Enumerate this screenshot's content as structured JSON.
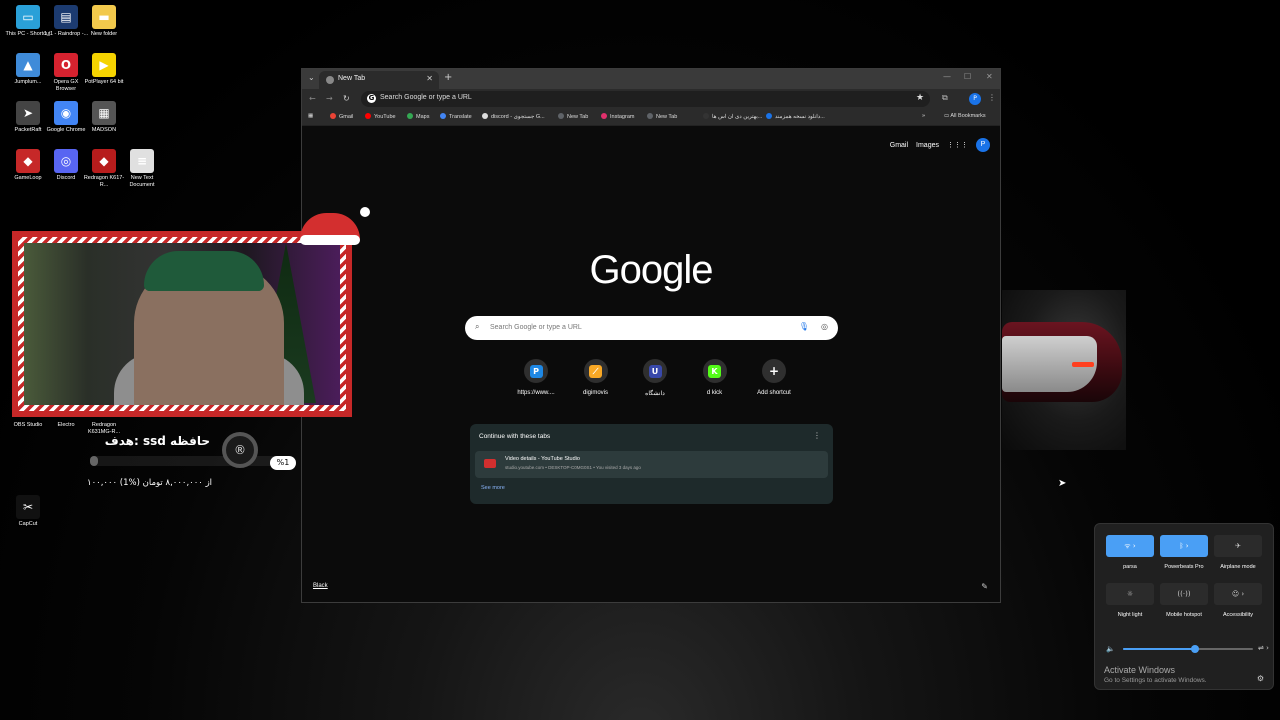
{
  "desktop": {
    "icons": [
      {
        "label": "This PC - Shortcut",
        "color": "#2aa0d8",
        "glyph": "▭"
      },
      {
        "label": "1_1 - Raindrop -...",
        "color": "#1c3b70",
        "glyph": "▤"
      },
      {
        "label": "New folder",
        "color": "#f2c94c",
        "glyph": "▬"
      },
      {
        "label": "Jumplum...",
        "color": "#3f8bd9",
        "glyph": "▲"
      },
      {
        "label": "Opera GX Browser",
        "color": "#d6222f",
        "glyph": "O"
      },
      {
        "label": "PotPlayer 64 bit",
        "color": "#f5d300",
        "glyph": "▶"
      },
      {
        "label": "PacketRaft",
        "color": "#444444",
        "glyph": "➤"
      },
      {
        "label": "Google Chrome",
        "color": "#4285f4",
        "glyph": "◉"
      },
      {
        "label": "MADSON",
        "color": "#555555",
        "glyph": "▦"
      },
      {
        "label": "GameLoop",
        "color": "#c62828",
        "glyph": "◆"
      },
      {
        "label": "Discord",
        "color": "#5865f2",
        "glyph": "◎"
      },
      {
        "label": "Redragon K617-R...",
        "color": "#b71c1c",
        "glyph": "◆"
      },
      {
        "label": "New Text Document",
        "color": "#e0e0e0",
        "glyph": "≡"
      },
      {
        "label": "CapCut",
        "color": "#111111",
        "glyph": "✂"
      }
    ],
    "under_cam_icons": [
      "OBS Studio",
      "Electro",
      "Redragon K631MG-R..."
    ]
  },
  "browser": {
    "tab_title": "New Tab",
    "omnibox_text": "Search Google or type a URL",
    "profile_initial": "P",
    "bookmarks": [
      {
        "label": "Gmail",
        "color": "#ea4335"
      },
      {
        "label": "YouTube",
        "color": "#ff0000"
      },
      {
        "label": "Maps",
        "color": "#34a853"
      },
      {
        "label": "Translate",
        "color": "#4285f4"
      },
      {
        "label": "discord - جستجوی G...",
        "color": "#dddddd"
      },
      {
        "label": "New Tab",
        "color": "#5f6368"
      },
      {
        "label": "Instagram",
        "color": "#e1306c"
      },
      {
        "label": "New Tab",
        "color": "#5f6368"
      },
      {
        "label": "بهترین دی ان اس ها...",
        "color": "#333333"
      },
      {
        "label": "دانلود نسخه همزمند...",
        "color": "#1a73e8"
      }
    ],
    "all_bookmarks": "All Bookmarks"
  },
  "newtab": {
    "gmail": "Gmail",
    "images": "Images",
    "logo": "Google",
    "search_placeholder": "Search Google or type a URL",
    "shortcuts": [
      {
        "label": "https://www....",
        "color": "#1e88e5",
        "glyph": "P"
      },
      {
        "label": "digimovis",
        "color": "#f9a825",
        "glyph": "⟋"
      },
      {
        "label": "دانشگاه",
        "color": "#3949ab",
        "glyph": "U"
      },
      {
        "label": "d kick",
        "color": "#53fc18",
        "glyph": "K"
      },
      {
        "label": "Add shortcut",
        "color": "#2f2f2f",
        "glyph": "+"
      }
    ],
    "continue_title": "Continue with these tabs",
    "continue_item_title": "Video details - YouTube Studio",
    "continue_item_sub": "studio.youtube.com • DESKTOP-C0MG0S1 • You visited 3 days ago",
    "see_more": "See more",
    "footer_link": "Black"
  },
  "stream_overlay": {
    "goal_title": "هدف: ssd حافظه",
    "goal_percent_label": "%1",
    "goal_amount": "۱۰۰,۰۰۰ از ۸,۰۰۰,۰۰۰ تومان (%1)",
    "goal_fraction": 0.0125
  },
  "quick_settings": {
    "tiles": [
      {
        "label": "parsa",
        "state": "on",
        "glyph": "ᯤ ›"
      },
      {
        "label": "Powerbeats Pro",
        "state": "on",
        "glyph": "ᛒ ›"
      },
      {
        "label": "Airplane mode",
        "state": "off",
        "glyph": "✈"
      },
      {
        "label": "Night light",
        "state": "off",
        "glyph": "☼"
      },
      {
        "label": "Mobile hotspot",
        "state": "off",
        "glyph": "((·))"
      },
      {
        "label": "Accessibility",
        "state": "off",
        "glyph": "☺ ›"
      }
    ],
    "volume_fraction": 0.55,
    "activate_title": "Activate Windows",
    "activate_sub": "Go to Settings to activate Windows."
  }
}
